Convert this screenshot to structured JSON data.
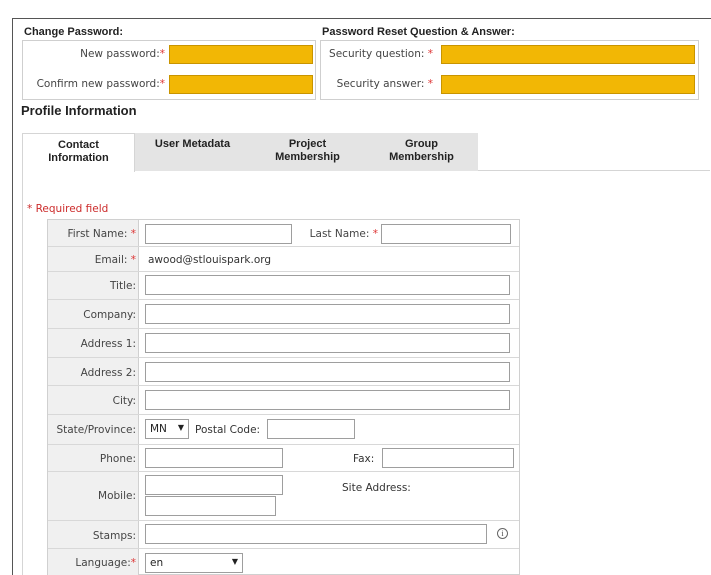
{
  "change_password": {
    "title": "Change Password:",
    "new_password_label": "New password:",
    "confirm_password_label": "Confirm new password:",
    "required_mark": "*"
  },
  "reset_qa": {
    "title": "Password Reset Question & Answer:",
    "security_question_label": "Security question:",
    "security_answer_label": "Security answer:",
    "required_mark": "*"
  },
  "colors": {
    "highlight_field": "#f2b705",
    "required": "#cc2b2b",
    "label_bg": "#f0f0f0",
    "inactive_tab": "#e4e4e4"
  },
  "profile": {
    "title": "Profile Information",
    "tabs": [
      {
        "line1": "Contact",
        "line2": "Information",
        "active": true
      },
      {
        "line1": "User Metadata",
        "line2": "",
        "active": false
      },
      {
        "line1": "Project",
        "line2": "Membership",
        "active": false
      },
      {
        "line1": "Group",
        "line2": "Membership",
        "active": false
      }
    ]
  },
  "form": {
    "required_note": "* Required field",
    "required_mark": "*",
    "first_name_label": "First Name:",
    "last_name_label": "Last Name:",
    "email_label": "Email:",
    "email_value": "awood@stlouispark.org",
    "title_label": "Title:",
    "company_label": "Company:",
    "address1_label": "Address 1:",
    "address2_label": "Address 2:",
    "city_label": "City:",
    "state_label": "State/Province:",
    "state_value": "MN",
    "postal_label": "Postal Code:",
    "phone_label": "Phone:",
    "fax_label": "Fax:",
    "mobile_label": "Mobile:",
    "site_address_label": "Site Address:",
    "stamps_label": "Stamps:",
    "language_label": "Language:",
    "language_value": "en",
    "info_icon": "i"
  }
}
